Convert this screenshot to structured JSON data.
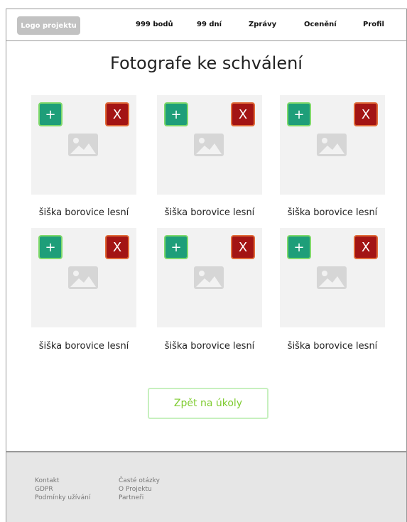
{
  "header": {
    "logo_label": "Logo projektu",
    "nav": [
      "999 bodů",
      "99 dní",
      "Zprávy",
      "Ocenění",
      "Profil"
    ]
  },
  "page": {
    "title": "Fotografe ke schválení"
  },
  "cards": [
    {
      "caption": "šiška borovice lesní",
      "approve_label": "+",
      "reject_label": "X"
    },
    {
      "caption": "šiška borovice lesní",
      "approve_label": "+",
      "reject_label": "X"
    },
    {
      "caption": "šiška borovice lesní",
      "approve_label": "+",
      "reject_label": "X"
    },
    {
      "caption": "šiška borovice lesní",
      "approve_label": "+",
      "reject_label": "X"
    },
    {
      "caption": "šiška borovice lesní",
      "approve_label": "+",
      "reject_label": "X"
    },
    {
      "caption": "šiška borovice lesní",
      "approve_label": "+",
      "reject_label": "X"
    }
  ],
  "icons": {
    "placeholder": "image-placeholder-icon"
  },
  "back_button": {
    "label": "Zpět na úkoly"
  },
  "footer": {
    "col1": [
      "Kontakt",
      "GDPR",
      "Podmínky užívání"
    ],
    "col2": [
      "Časté otázky",
      "O Projektu",
      "Partneři"
    ]
  },
  "colors": {
    "approve": "#1e9e79",
    "reject": "#a31414",
    "accent_green": "#7ecb2f",
    "footer_bg": "#e6e6e6"
  }
}
